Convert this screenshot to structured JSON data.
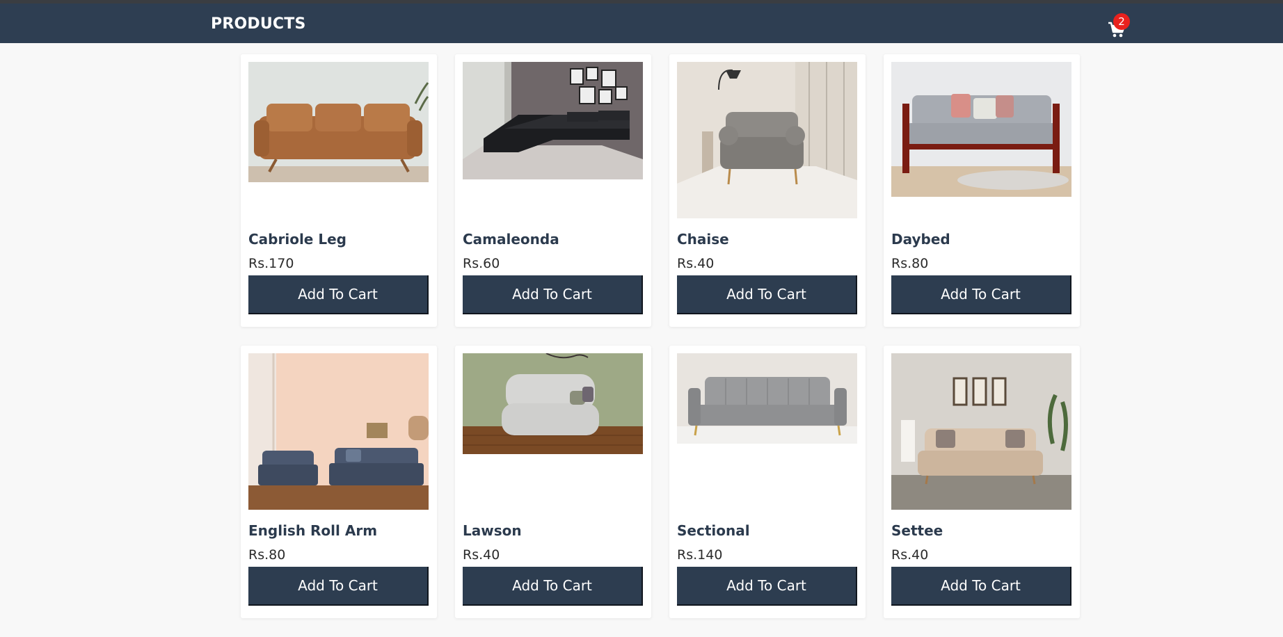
{
  "nav": {
    "title": "PRODUCTS",
    "cart_count": "2"
  },
  "colors": {
    "navbar": "#2e3e52",
    "button": "#2d3d50",
    "badge": "#e8211e",
    "page_bg": "#f8f8f8"
  },
  "products": [
    {
      "name": "Cabriole Leg",
      "price": "Rs.170",
      "button": "Add To Cart",
      "image": "tan-leather-sofa"
    },
    {
      "name": "Camaleonda",
      "price": "Rs.60",
      "button": "Add To Cart",
      "image": "black-sectional-sofa"
    },
    {
      "name": "Chaise",
      "price": "Rs.40",
      "button": "Add To Cart",
      "image": "grey-armchair"
    },
    {
      "name": "Daybed",
      "price": "Rs.80",
      "button": "Add To Cart",
      "image": "grey-wooden-daybed"
    },
    {
      "name": "English Roll Arm",
      "price": "Rs.80",
      "button": "Add To Cart",
      "image": "blue-sofa-set"
    },
    {
      "name": "Lawson",
      "price": "Rs.40",
      "button": "Add To Cart",
      "image": "light-grey-loveseat"
    },
    {
      "name": "Sectional",
      "price": "Rs.140",
      "button": "Add To Cart",
      "image": "grey-channel-sofa"
    },
    {
      "name": "Settee",
      "price": "Rs.40",
      "button": "Add To Cart",
      "image": "beige-settee"
    }
  ]
}
